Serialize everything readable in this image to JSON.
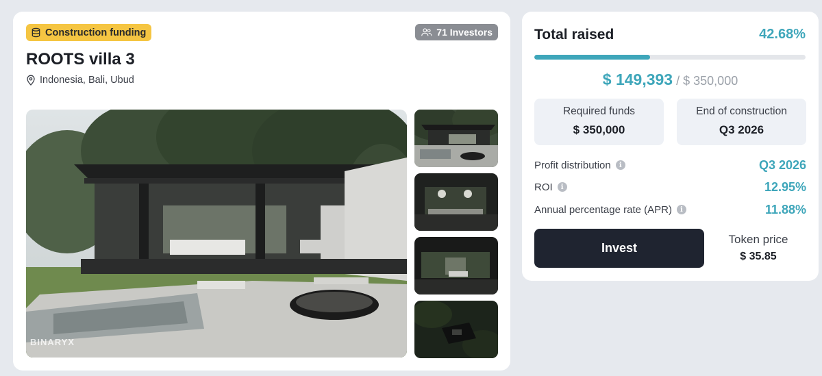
{
  "project": {
    "badge": "Construction funding",
    "investors": "71 Investors",
    "title": "ROOTS villa 3",
    "location": "Indonesia, Bali, Ubud",
    "watermark": "BINARYX",
    "badge_icon": "database-icon",
    "investors_icon": "users-icon",
    "location_icon": "map-pin-icon"
  },
  "funding": {
    "total_label": "Total raised",
    "percent": "42.68%",
    "progress_fraction": 0.4268,
    "raised": "$ 149,393",
    "separator": "/",
    "goal": "$ 350,000",
    "required_label": "Required funds",
    "required_value": "$ 350,000",
    "end_label": "End of construction",
    "end_value": "Q3 2026",
    "rows": [
      {
        "label": "Profit distribution",
        "value": "Q3 2026"
      },
      {
        "label": "ROI",
        "value": "12.95%"
      },
      {
        "label": "Annual percentage rate (APR)",
        "value": "11.88%"
      }
    ],
    "invest_label": "Invest",
    "token_label": "Token price",
    "token_value": "$ 35.85"
  },
  "colors": {
    "accent": "#3ea6ba",
    "badge": "#f5c542",
    "button": "#1f2430",
    "background": "#e6e9ee"
  }
}
